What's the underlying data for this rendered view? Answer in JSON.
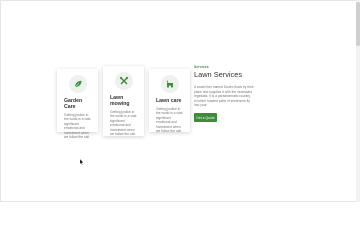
{
  "cards": [
    {
      "title": "Garden Care",
      "body": "Getting justice in the world is a vast significant emotional and investment when we follow the call.",
      "icon": "leaf-icon"
    },
    {
      "title": "Lawn mowing",
      "body": "Getting justice in the world is a vast significant emotional and investment when we follow the call.",
      "icon": "tools-icon"
    },
    {
      "title": "Lawn care",
      "body": "Getting justice in the world is a vast significant emotional and investment when we follow the call.",
      "icon": "lawnmower-icon"
    }
  ],
  "services": {
    "eyebrow": "Services",
    "title": "Lawn Services",
    "description": "A small river named Duden flows by their place and supplies it with the necessary regelialia. It is a paradisematic country, in which roasted parts of sentences fly into your.",
    "button_label": "Get a Quote"
  },
  "colors": {
    "accent": "#3b8d36",
    "icon_bg": "#eef2ec"
  }
}
